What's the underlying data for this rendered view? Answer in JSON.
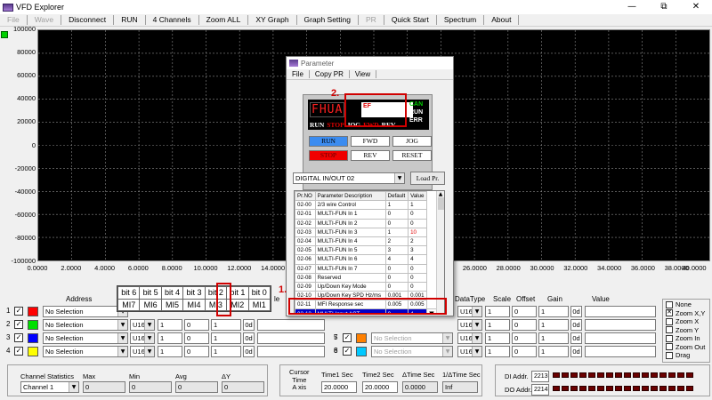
{
  "window": {
    "title": "VFD Explorer",
    "minimize": "—",
    "maximize": "⧉",
    "close": "✕"
  },
  "menu": [
    {
      "label": "File",
      "enabled": false
    },
    {
      "label": "Wave",
      "enabled": false
    },
    {
      "label": "Disconnect",
      "enabled": true
    },
    {
      "label": "RUN",
      "enabled": true
    },
    {
      "label": "4 Channels",
      "enabled": true
    },
    {
      "label": "Zoom ALL",
      "enabled": true
    },
    {
      "label": "XY Graph",
      "enabled": true
    },
    {
      "label": "Graph Setting",
      "enabled": true
    },
    {
      "label": "PR",
      "enabled": false
    },
    {
      "label": "Quick Start",
      "enabled": true
    },
    {
      "label": "Spectrum",
      "enabled": true
    },
    {
      "label": "About",
      "enabled": true
    }
  ],
  "graph": {
    "y_ticks": [
      "100000",
      "80000",
      "60000",
      "40000",
      "20000",
      "0",
      "-20000",
      "-40000",
      "-60000",
      "-80000",
      "-100000"
    ],
    "x_ticks": [
      "0.0000",
      "2.0000",
      "4.0000",
      "6.0000",
      "8.0000",
      "10.0000",
      "12.0000",
      "14.0000",
      "",
      "",
      "",
      "",
      "",
      "26.0000",
      "28.0000",
      "30.0000",
      "32.0000",
      "34.0000",
      "36.0000",
      "38.0000",
      "40.0000"
    ],
    "background": "#000000",
    "grid_color": "#8a8a8a"
  },
  "channels_header": {
    "address": "Address",
    "datatype": "DataType",
    "scale": "Scale",
    "offset": "Offset",
    "gain": "Gain",
    "value": "Value"
  },
  "channels_left": [
    {
      "num": "1",
      "color": "#ff0000",
      "address": "No Selection",
      "type": "",
      "scale": "",
      "offset": "",
      "gain": "",
      "unit": ""
    },
    {
      "num": "2",
      "color": "#00e000",
      "address": "No Selection",
      "type": "U16",
      "scale": "1",
      "offset": "0",
      "gain": "1",
      "unit": "0d"
    },
    {
      "num": "3",
      "color": "#0000ff",
      "address": "No Selection",
      "type": "U16",
      "scale": "1",
      "offset": "0",
      "gain": "1",
      "unit": "0d"
    },
    {
      "num": "4",
      "color": "#ffff00",
      "address": "No Selection",
      "type": "U16",
      "scale": "1",
      "offset": "0",
      "gain": "1",
      "unit": "0d"
    }
  ],
  "channels_right": [
    {
      "num": "",
      "color": "",
      "address": "",
      "type": "U16",
      "scale": "1",
      "offset": "0",
      "gain": "1",
      "unit": "0d"
    },
    {
      "num": "",
      "color": "",
      "address": "",
      "type": "U16",
      "scale": "1",
      "offset": "0",
      "gain": "1",
      "unit": "0d"
    },
    {
      "num": "7",
      "color": "#00c8c8",
      "address": "No Selection",
      "type": "U16",
      "scale": "1",
      "offset": "0",
      "gain": "1",
      "unit": "0d"
    },
    {
      "num": "8",
      "color": "#008000",
      "address": "No Selection",
      "type": "U16",
      "scale": "1",
      "offset": "0",
      "gain": "1",
      "unit": "0d"
    }
  ],
  "channel_5_6": [
    {
      "num": "5",
      "color": "#ff8000",
      "address": "No Selection"
    },
    {
      "num": "6",
      "color": "#00c8ff",
      "address": "No Selection"
    }
  ],
  "bit_table": {
    "bits": [
      "bit 6",
      "bit 5",
      "bit 4",
      "bit 3",
      "bit 2",
      "bit 1",
      "bit 0"
    ],
    "inputs": [
      "MI7",
      "MI6",
      "MI5",
      "MI4",
      "MI3",
      "MI2",
      "MI1"
    ]
  },
  "zoom_options": [
    {
      "label": "None",
      "checked": false
    },
    {
      "label": "Zoom X,Y",
      "checked": true
    },
    {
      "label": "Zoom X",
      "checked": false
    },
    {
      "label": "Zoom Y",
      "checked": false
    },
    {
      "label": "Zoom In",
      "checked": false
    },
    {
      "label": "Zoom Out",
      "checked": false
    },
    {
      "label": "Drag",
      "checked": false
    }
  ],
  "stats": {
    "title": "Channel Statistics",
    "channel": "Channel 1",
    "max_label": "Max",
    "min_label": "Min",
    "avg_label": "Avg",
    "dy_label": "ΔY",
    "max": "0",
    "min": "0",
    "avg": "0",
    "dy": "0"
  },
  "cursor": {
    "title": "Cursor\nTime\nA xis",
    "t1_label": "Time1 Sec",
    "t1": "20.0000",
    "t2_label": "Time2 Sec",
    "t2": "20.0000",
    "dt_label": "ΔTime Sec",
    "dt": "0.0000",
    "inv_label": "1/ΔTime Sec",
    "inv": "Inf"
  },
  "io": {
    "di_label": "DI Addr.",
    "di": "2213",
    "do_label": "DO Addr.",
    "do": "2214"
  },
  "dialog": {
    "title": "Parameter",
    "menu": [
      "File",
      "Copy PR",
      "View"
    ],
    "lcd_main": "FHUA",
    "lcd_entry": "EF",
    "lcd_can": "CAN",
    "lcd_run": "RUN",
    "lcd_err": "ERR",
    "lcd_status": [
      "RUN",
      "STOP",
      "JOG",
      "FWD",
      "REV"
    ],
    "keys": [
      "RUN",
      "FWD",
      "JOG",
      "STOP",
      "REV",
      "RESET"
    ],
    "group_select": "DIGITAL IN/OUT  02",
    "load_button": "Load Pr.",
    "table_headers": [
      "Pr.NO",
      "Parameter Description",
      "Default",
      "Value"
    ],
    "rows": [
      {
        "no": "02-00",
        "desc": "2/3 wire Control",
        "def": "1",
        "val": "1",
        "red": false
      },
      {
        "no": "02-01",
        "desc": "MULTI-FUN In 1",
        "def": "0",
        "val": "0",
        "red": false
      },
      {
        "no": "02-02",
        "desc": "MULTI-FUN In 2",
        "def": "0",
        "val": "0",
        "red": false
      },
      {
        "no": "02-03",
        "desc": "MULTI-FUN In 3",
        "def": "1",
        "val": "10",
        "red": true
      },
      {
        "no": "02-04",
        "desc": "MULTI-FUN In 4",
        "def": "2",
        "val": "2",
        "red": false
      },
      {
        "no": "02-05",
        "desc": "MULTI-FUN In 5",
        "def": "3",
        "val": "3",
        "red": false
      },
      {
        "no": "02-06",
        "desc": "MULTI-FUN In 6",
        "def": "4",
        "val": "4",
        "red": false
      },
      {
        "no": "02-07",
        "desc": "MULTI-FUN In 7",
        "def": "0",
        "val": "0",
        "red": false
      },
      {
        "no": "02-08",
        "desc": "Reserved",
        "def": "0",
        "val": "0",
        "red": false
      },
      {
        "no": "02-09",
        "desc": "Up/Down Key Mode",
        "def": "0",
        "val": "0",
        "red": false
      },
      {
        "no": "02-10",
        "desc": "Up/Down Key SPD Hz/ms",
        "def": "0.001",
        "val": "0.001",
        "red": false
      },
      {
        "no": "02-11",
        "desc": "MFI Response    sec",
        "def": "0.005",
        "val": "0.005",
        "red": false
      },
      {
        "no": "02-12",
        "desc": "MULTI-Input ACT",
        "def": "0",
        "val": "4",
        "red": false
      }
    ],
    "selected_row": 12
  },
  "annotations": {
    "one": "1.",
    "two": "2."
  }
}
